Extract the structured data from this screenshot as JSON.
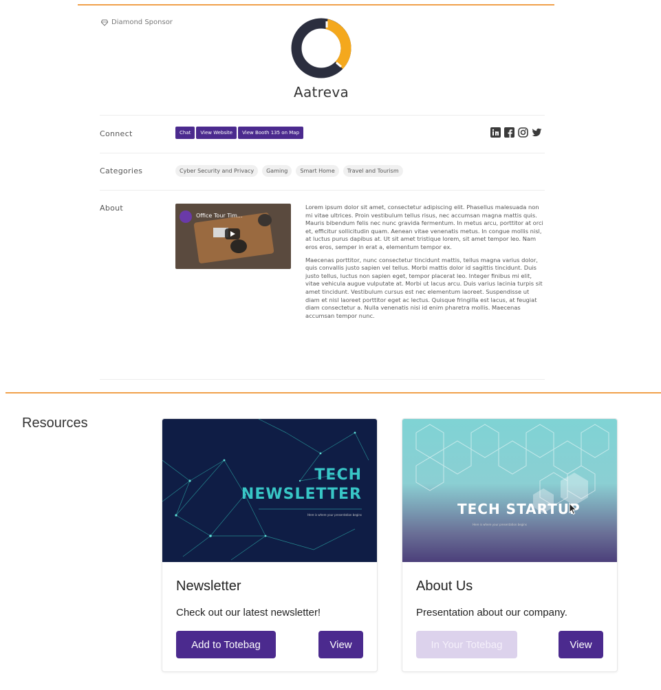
{
  "sponsor": {
    "tier": "Diamond Sponsor",
    "company_name": "Aatreva",
    "brand_colors": {
      "ring_dark": "#2b2e3e",
      "ring_accent": "#f4a81d"
    }
  },
  "connect": {
    "label": "Connect",
    "buttons": [
      "Chat",
      "View Website",
      "View Booth 135 on Map"
    ],
    "social_icons": [
      "linkedin-icon",
      "facebook-icon",
      "instagram-icon",
      "twitter-icon"
    ]
  },
  "categories": {
    "label": "Categories",
    "items": [
      "Cyber Security and Privacy",
      "Gaming",
      "Smart Home",
      "Travel and Tourism"
    ]
  },
  "about": {
    "label": "About",
    "video_title": "Office Tour Tim...",
    "paragraphs": [
      "Lorem ipsum dolor sit amet, consectetur adipiscing elit. Phasellus malesuada non mi vitae ultrices. Proin vestibulum tellus risus, nec accumsan magna mattis quis. Mauris bibendum felis nec nunc gravida fermentum. In metus arcu, porttitor at orci et, efficitur sollicitudin quam. Aenean vitae venenatis metus. In congue mollis nisl, at luctus purus dapibus at. Ut sit amet tristique lorem, sit amet tempor leo. Nam eros eros, semper in erat a, elementum tempor ex.",
      "Maecenas porttitor, nunc consectetur tincidunt mattis, tellus magna varius dolor, quis convallis justo sapien vel tellus. Morbi mattis dolor id sagittis tincidunt. Duis justo tellus, luctus non sapien eget, tempor placerat leo. Integer finibus mi elit, vitae vehicula augue vulputate at. Morbi ut lacus arcu. Duis varius lacinia turpis sit amet tincidunt. Vestibulum cursus est nec elementum laoreet. Suspendisse ut diam et nisl laoreet porttitor eget ac lectus. Quisque fringilla est lacus, at feugiat diam consectetur a. Nulla venenatis nisi id enim pharetra mollis. Maecenas accumsan tempor nunc."
    ]
  },
  "resources": {
    "title": "Resources",
    "cards": [
      {
        "thumb_title_line1": "TECH",
        "thumb_title_line2": "NEWSLETTER",
        "thumb_subtitle": "Here is where your presentation begins",
        "title": "Newsletter",
        "description": "Check out our latest newsletter!",
        "primary_label": "Add to Totebag",
        "primary_state": "enabled",
        "view_label": "View"
      },
      {
        "thumb_title_line1": "TECH STARTUP",
        "thumb_subtitle": "Here is where your presentation begins",
        "title": "About Us",
        "description": "Presentation about our company.",
        "primary_label": "In Your Totebag",
        "primary_state": "disabled",
        "view_label": "View"
      }
    ]
  },
  "colors": {
    "accent_purple": "#4b2a8e",
    "divider_orange": "#f0a04a",
    "newsletter_teal": "#38c6c6"
  }
}
